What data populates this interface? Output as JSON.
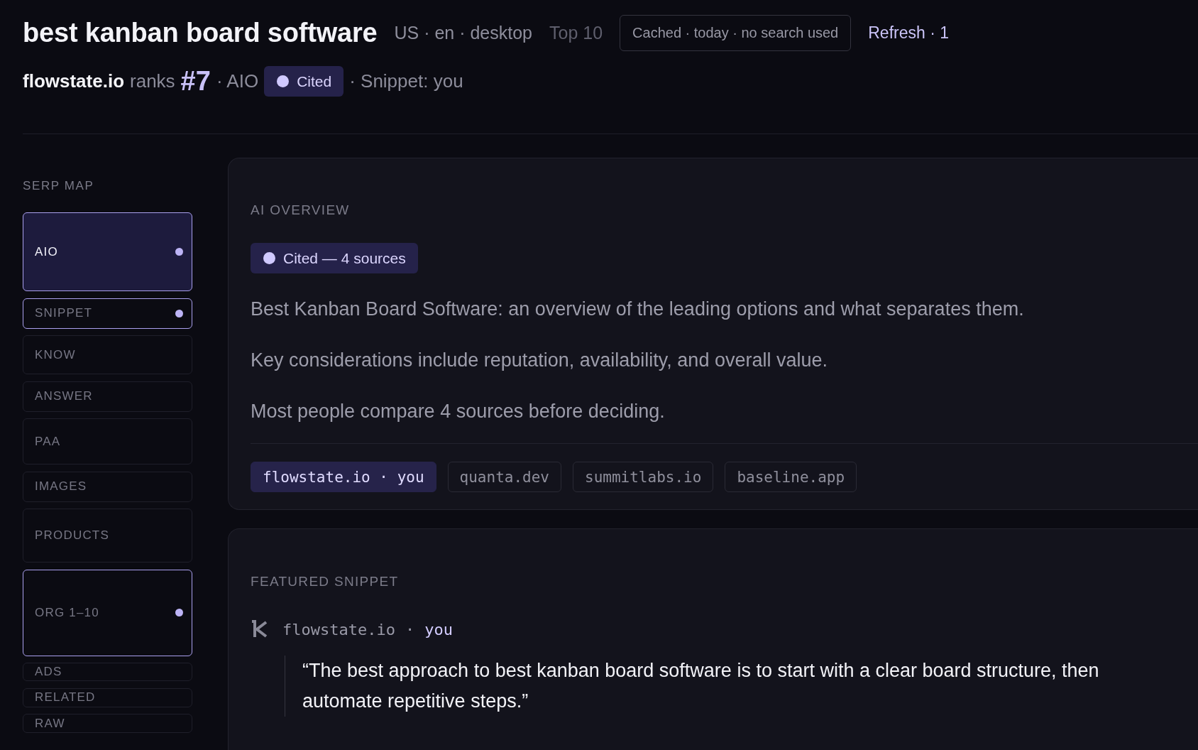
{
  "header": {
    "query": "best kanban board software",
    "context": "US · en · desktop",
    "scope": "Top 10",
    "cache_status": "Cached · today · no search used",
    "refresh_button": "Refresh · 1"
  },
  "summary": {
    "domain": "flowstate.io",
    "ranks_label": "ranks",
    "rank": "#7",
    "feature": "· AIO",
    "badge": "Cited",
    "snippet": "· Snippet: you"
  },
  "serp_map": {
    "title": "SERP MAP",
    "items": [
      {
        "label": "AIO",
        "selected": true,
        "cited": true
      },
      {
        "label": "SNIPPET",
        "selected": false,
        "cited": true
      },
      {
        "label": "KNOW",
        "selected": false,
        "cited": false
      },
      {
        "label": "ANSWER",
        "selected": false,
        "cited": false
      },
      {
        "label": "PAA",
        "selected": false,
        "cited": false
      },
      {
        "label": "IMAGES",
        "selected": false,
        "cited": false
      },
      {
        "label": "PRODUCTS",
        "selected": false,
        "cited": false
      },
      {
        "label": "ORG 1–10",
        "selected": false,
        "cited": true
      },
      {
        "label": "ADS",
        "selected": false,
        "cited": false
      },
      {
        "label": "RELATED",
        "selected": false,
        "cited": false
      },
      {
        "label": "RAW",
        "selected": false,
        "cited": false
      }
    ]
  },
  "ai_overview": {
    "title": "AI OVERVIEW",
    "badge": "Cited — 4 sources",
    "paragraphs": [
      "Best Kanban Board Software: an overview of the leading options and what separates them.",
      "Key considerations include reputation, availability, and overall value.",
      "Most people compare 4 sources before deciding."
    ],
    "sources": [
      {
        "label": "flowstate.io · you",
        "own": true
      },
      {
        "label": "quanta.dev",
        "own": false
      },
      {
        "label": "summitlabs.io",
        "own": false
      },
      {
        "label": "baseline.app",
        "own": false
      }
    ]
  },
  "featured_snippet": {
    "title": "FEATURED SNIPPET",
    "domain": "flowstate.io",
    "separator": "·",
    "owner": "you",
    "quote": "“The best approach to best kanban board software is to start with a clear board structure, then automate repetitive steps.”"
  }
}
